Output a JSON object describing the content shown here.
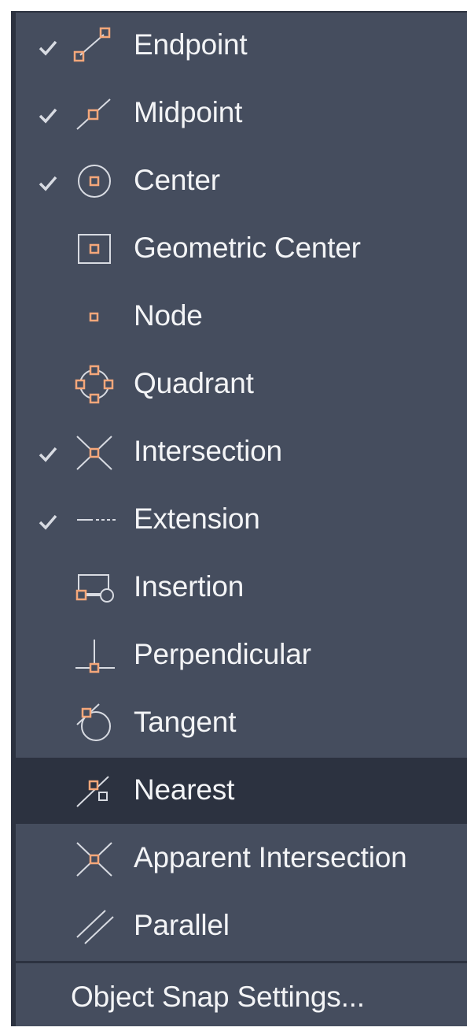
{
  "menu": {
    "items": [
      {
        "label": "Endpoint",
        "checked": true,
        "icon": "endpoint-icon"
      },
      {
        "label": "Midpoint",
        "checked": true,
        "icon": "midpoint-icon"
      },
      {
        "label": "Center",
        "checked": true,
        "icon": "center-icon"
      },
      {
        "label": "Geometric Center",
        "checked": false,
        "icon": "geometric-center-icon"
      },
      {
        "label": "Node",
        "checked": false,
        "icon": "node-icon"
      },
      {
        "label": "Quadrant",
        "checked": false,
        "icon": "quadrant-icon"
      },
      {
        "label": "Intersection",
        "checked": true,
        "icon": "intersection-icon"
      },
      {
        "label": "Extension",
        "checked": true,
        "icon": "extension-icon"
      },
      {
        "label": "Insertion",
        "checked": false,
        "icon": "insertion-icon"
      },
      {
        "label": "Perpendicular",
        "checked": false,
        "icon": "perpendicular-icon"
      },
      {
        "label": "Tangent",
        "checked": false,
        "icon": "tangent-icon"
      },
      {
        "label": "Nearest",
        "checked": false,
        "icon": "nearest-icon",
        "highlighted": true
      },
      {
        "label": "Apparent Intersection",
        "checked": false,
        "icon": "apparent-intersection-icon"
      },
      {
        "label": "Parallel",
        "checked": false,
        "icon": "parallel-icon"
      }
    ],
    "settings_label": "Object Snap Settings..."
  },
  "colors": {
    "background": "#454d5e",
    "highlight": "#2c3240",
    "text": "#f3f4f6",
    "icon_line": "#d8dbe2",
    "snap_marker": "#f5a77a"
  }
}
